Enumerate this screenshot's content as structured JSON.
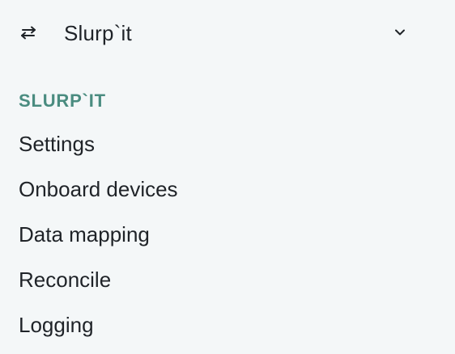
{
  "app_switcher": {
    "icon": "swap-arrows-icon",
    "app_name": "Slurp`it",
    "dropdown_icon": "chevron-down-icon"
  },
  "section": {
    "heading": "SLURP`IT"
  },
  "nav": {
    "items": [
      {
        "label": "Settings"
      },
      {
        "label": "Onboard devices"
      },
      {
        "label": "Data mapping"
      },
      {
        "label": "Reconcile"
      },
      {
        "label": "Logging"
      }
    ]
  },
  "colors": {
    "background": "#f4f7f8",
    "text": "#1f2328",
    "section_heading": "#4a8c80"
  }
}
